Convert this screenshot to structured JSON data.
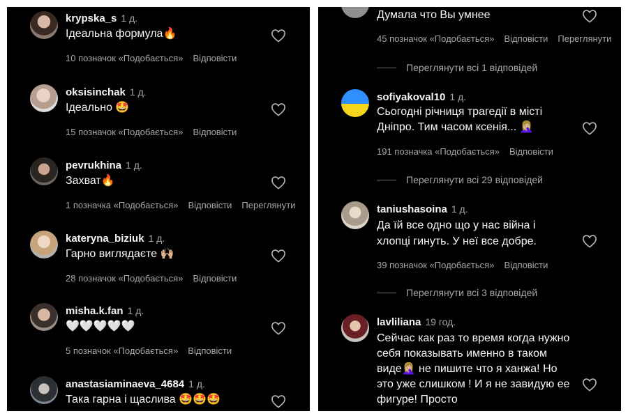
{
  "left_panel": {
    "comments": [
      {
        "username": "krypska_s",
        "time": "1 д.",
        "text": "Ідеальна формула🔥",
        "likes": "10 позначок «Подобається»",
        "reply": "Відповісти"
      },
      {
        "username": "oksisinchak",
        "time": "1 д.",
        "text": "Ідеально 🤩",
        "likes": "15 позначок «Подобається»",
        "reply": "Відповісти"
      },
      {
        "username": "pevrukhina",
        "time": "1 д.",
        "text": "Захват🔥",
        "likes": "1 позначка «Подобається»",
        "reply": "Відповісти",
        "extra": "Переглянути"
      },
      {
        "username": "kateryna_biziuk",
        "time": "1 д.",
        "text": "Гарно виглядаєте 🙌🏼",
        "likes": "28 позначок «Подобається»",
        "reply": "Відповісти"
      },
      {
        "username": "misha.k.fan",
        "time": "1 д.",
        "text": "🤍🤍🤍🤍🤍",
        "likes": "5 позначок «Подобається»",
        "reply": "Відповісти"
      },
      {
        "username": "anastasiaminaeva_4684",
        "time": "1 д.",
        "text": "Така гарна і щаслива 🤩🤩🤩"
      }
    ]
  },
  "right_panel": {
    "top_comment": {
      "text": "Думала что Вы умнее",
      "likes": "45 позначок «Подобається»",
      "reply": "Відповісти",
      "extra": "Переглянути",
      "thread": "Переглянути всі 1 відповідей"
    },
    "comments": [
      {
        "username": "sofiyakoval10",
        "time": "1 д.",
        "text": "Сьогодні річниця трагедії в місті Дніпро. Тим часом ксенія... 🤦🏼‍♀️",
        "likes": "191 позначка «Подобається»",
        "reply": "Відповісти",
        "thread": "Переглянути всі 29 відповідей"
      },
      {
        "username": "taniushasoina",
        "time": "1 д.",
        "text": "Да їй все одно що у нас війна і хлопці гинуть. У неї все добре.",
        "likes": "39 позначок «Подобається»",
        "reply": "Відповісти",
        "thread": "Переглянути всі 3 відповідей"
      },
      {
        "username": "lavliliana",
        "time": "19 год.",
        "text": "Сейчас как раз то время когда нужно себя показывать именно в таком виде🤦🏼‍♀️ не пишите что я ханжа! Но это уже слишком ! И я не завидую ее фигуре! Просто"
      }
    ]
  }
}
